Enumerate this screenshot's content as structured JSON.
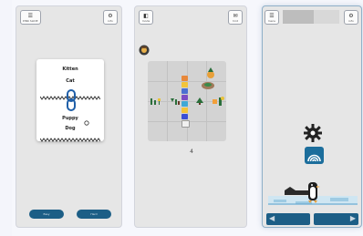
{
  "phone1": {
    "top_left": {
      "glyph": "☰",
      "label": "PINK SLIDE"
    },
    "top_right": {
      "glyph": "⚙",
      "label": "info"
    },
    "card": {
      "word_top": "Kitten",
      "word_a": "Cat",
      "word_b": "Puppy",
      "word_c": "Dog"
    },
    "left_button": "Easy",
    "right_button": "Hard"
  },
  "phone2": {
    "top_left": {
      "glyph": "◧",
      "label": "mode"
    },
    "top_right": {
      "glyph": "✉",
      "label": "hint"
    },
    "counter": "4"
  },
  "phone3": {
    "top_left": {
      "glyph": "☰",
      "label": "menu"
    },
    "top_right": {
      "glyph": "⚙",
      "label": "info"
    },
    "colors": {
      "primary": "#1c5e86",
      "bar_a": "#9ecbe3",
      "bar_b": "#5b9fc8"
    },
    "left_arrow": "◀",
    "right_arrow": "▶"
  }
}
